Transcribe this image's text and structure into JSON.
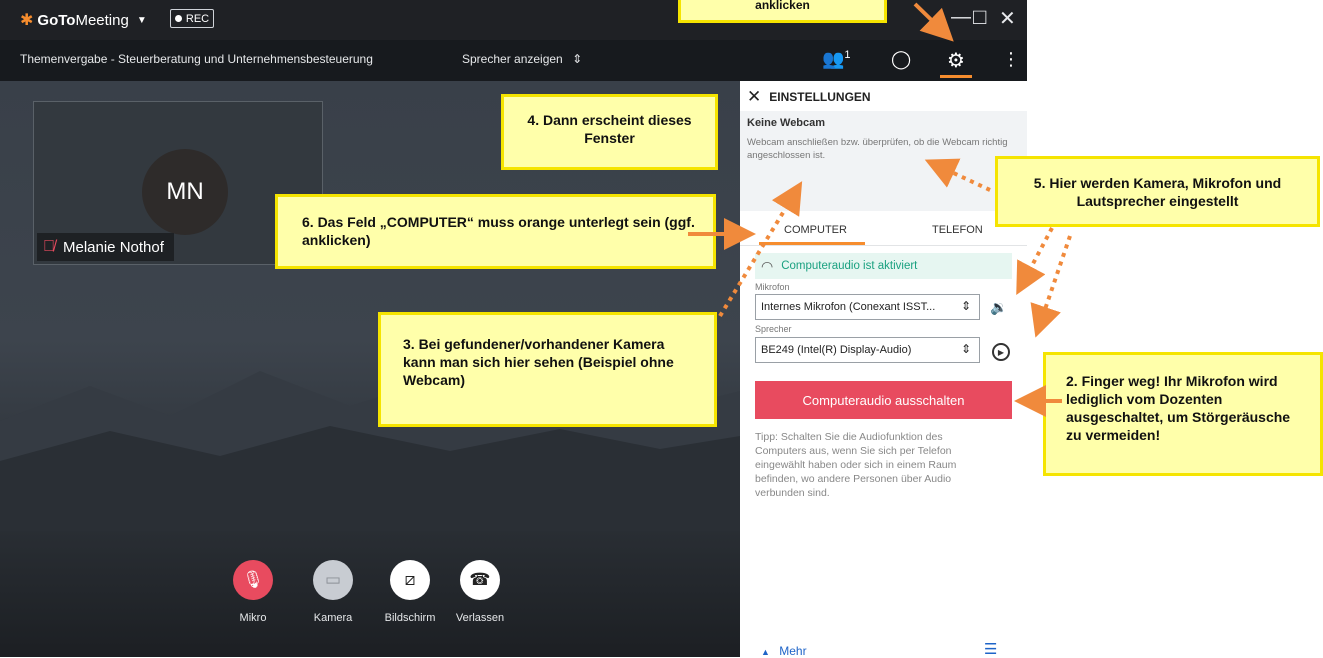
{
  "app": {
    "brand_goto": "GoTo",
    "brand_meeting": "Meeting",
    "rec_label": "REC",
    "meeting_title": "Themenvergabe - Steuerberatung und  Unternehmensbesteuerung",
    "view_selector": "Sprecher anzeigen",
    "participant_count": "1"
  },
  "participant": {
    "initials": "MN",
    "name": "Melanie Nothof"
  },
  "controls": [
    {
      "label": "Mikro",
      "icon": "mic-off-icon"
    },
    {
      "label": "Kamera",
      "icon": "camera-off-icon"
    },
    {
      "label": "Bildschirm",
      "icon": "screen-share-icon"
    },
    {
      "label": "Verlassen",
      "icon": "hang-up-icon"
    }
  ],
  "settings": {
    "title": "EINSTELLUNGEN",
    "webcam_title": "Keine Webcam",
    "webcam_text": "Webcam anschließen bzw. überprüfen, ob die Webcam richtig angeschlossen ist.",
    "tab_computer": "COMPUTER",
    "tab_phone": "TELEFON",
    "audio_status": "Computeraudio ist aktiviert",
    "mic_label": "Mikrofon",
    "mic_value": "Internes  Mikrofon  (Conexant  ISST...",
    "speaker_label": "Sprecher",
    "speaker_value": "BE249 (Intel(R) Display-Audio)",
    "audio_off_button": "Computeraudio ausschalten",
    "tip": "Tipp: Schalten Sie die Audiofunktion des Computers aus, wenn Sie sich per Telefon eingewählt haben oder sich in einem Raum befinden, wo andere Personen über Audio verbunden sind.",
    "more_label": "Mehr"
  },
  "annotations": {
    "top_partial": "anklicken",
    "note2": "2. Finger weg! Ihr Mikrofon wird lediglich vom Dozenten ausgeschaltet, um Störgeräusche zu vermeiden!",
    "note3": "3. Bei gefundener/vorhandener Kamera kann man sich hier sehen (Beispiel ohne Webcam)",
    "note4": "4. Dann erscheint dieses Fenster",
    "note5": "5. Hier werden Kamera, Mikrofon und Lautsprecher eingestellt",
    "note6": "6. Das Feld „COMPUTER“ muss orange unterlegt sein (ggf. anklicken)"
  },
  "colors": {
    "accent_orange": "#f68d2e",
    "mute_red": "#e84b5f",
    "note_yellow": "#ffffaa",
    "note_border": "#f5e400"
  }
}
